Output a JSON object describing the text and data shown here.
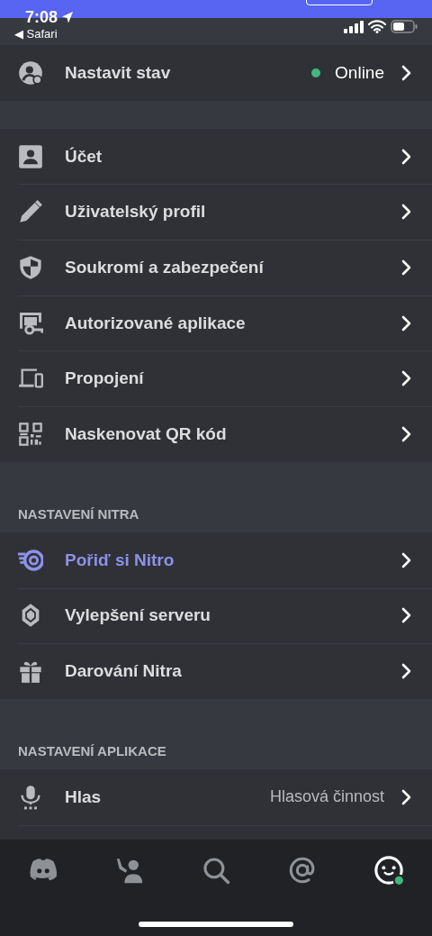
{
  "status_bar": {
    "time": "7:08",
    "back_link": "◀ Safari"
  },
  "groups": [
    {
      "items": [
        {
          "label": "Nastavit stav",
          "status": "Online",
          "color": "#43b581",
          "highlighted": false
        }
      ]
    },
    {
      "items": [
        {
          "label": "Účet",
          "highlighted": false
        },
        {
          "label": "Uživatelský profil",
          "highlighted": false
        },
        {
          "label": "Soukromí a zabezpečení",
          "highlighted": false
        },
        {
          "label": "Autorizované aplikace",
          "highlighted": false
        },
        {
          "label": "Propojení",
          "highlighted": false
        },
        {
          "label": "Naskenovat QR kód",
          "highlighted": false
        }
      ]
    },
    {
      "header": "NASTAVENÍ NITRA",
      "items": [
        {
          "label": "Pořiď si Nitro",
          "highlighted": true
        },
        {
          "label": "Vylepšení serveru",
          "highlighted": false
        },
        {
          "label": "Darování Nitra",
          "highlighted": false
        }
      ]
    },
    {
      "header": "NASTAVENÍ APLIKACE",
      "items": [
        {
          "label": "Hlas",
          "value": "Hlasová činnost",
          "highlighted": false
        }
      ]
    }
  ],
  "tabs": [
    {
      "selected": false
    },
    {
      "selected": false
    },
    {
      "selected": false
    },
    {
      "selected": false
    },
    {
      "selected": true
    }
  ]
}
